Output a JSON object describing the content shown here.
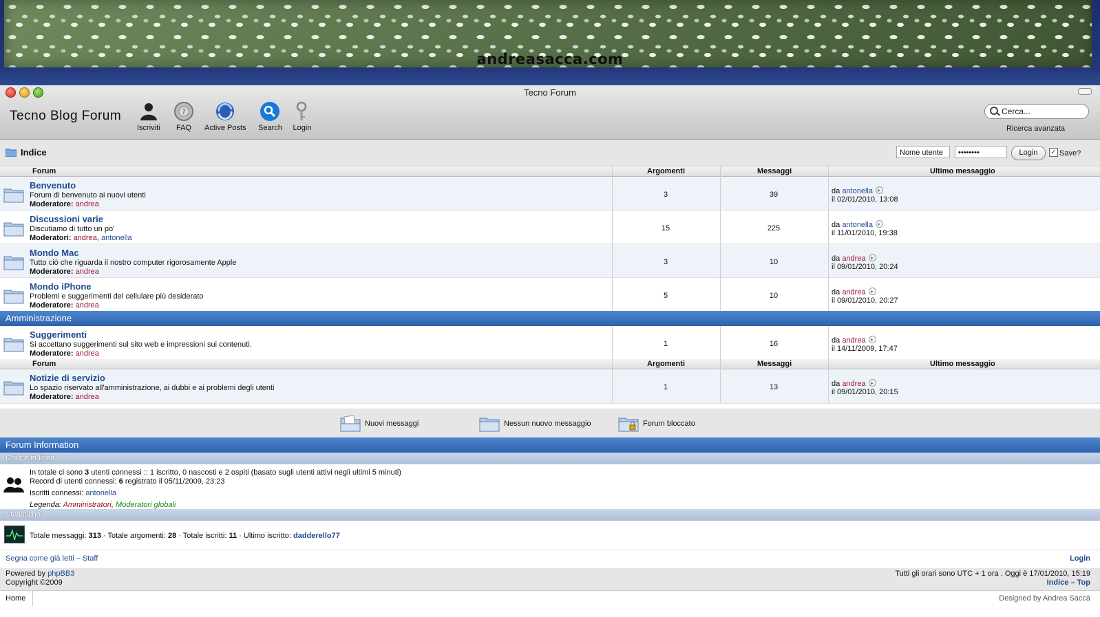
{
  "banner": {
    "site": "andreasacca.com"
  },
  "window": {
    "title": "Tecno Forum"
  },
  "header": {
    "brand": "Tecno Blog Forum",
    "toolbar": [
      {
        "label": "Iscriviti",
        "icon": "user-icon"
      },
      {
        "label": "FAQ",
        "icon": "faq-icon"
      },
      {
        "label": "Active Posts",
        "icon": "active-posts-icon"
      },
      {
        "label": "Search",
        "icon": "search-icon"
      },
      {
        "label": "Login",
        "icon": "key-icon"
      }
    ],
    "search_placeholder": "Cerca...",
    "advanced_search": "Ricerca avanzata"
  },
  "crumb": {
    "label": "Indice",
    "username_value": "Nome utente",
    "password_value": "••••••••",
    "login_button": "Login",
    "save_label": "Save?"
  },
  "table": {
    "headers": {
      "forum": "Forum",
      "topics": "Argomenti",
      "posts": "Messaggi",
      "last": "Ultimo messaggio"
    },
    "rows": [
      {
        "name": "Benvenuto",
        "desc": "Forum di benvenuto ai nuovi utenti",
        "mod_label": "Moderatore:",
        "mods": "andrea",
        "mods2": "",
        "topics": "3",
        "posts": "39",
        "last_by_prefix": "da",
        "last_by": "antonella",
        "last_date": "il 02/01/2010, 13:08"
      },
      {
        "name": "Discussioni varie",
        "desc": "Discutiamo di tutto un po'",
        "mod_label": "Moderatori:",
        "mods": "andrea",
        "mods2": "antonella",
        "topics": "15",
        "posts": "225",
        "last_by_prefix": "da",
        "last_by": "antonella",
        "last_date": "il 11/01/2010, 19:38"
      },
      {
        "name": "Mondo Mac",
        "desc": "Tutto ciò che riguarda il nostro computer rigorosamente Apple",
        "mod_label": "Moderatore:",
        "mods": "andrea",
        "mods2": "",
        "topics": "3",
        "posts": "10",
        "last_by_prefix": "da",
        "last_by": "andrea",
        "last_date": "il 09/01/2010, 20:24"
      },
      {
        "name": "Mondo iPhone",
        "desc": "Problemi e suggerimenti del cellulare più desiderato",
        "mod_label": "Moderatore:",
        "mods": "andrea",
        "mods2": "",
        "topics": "5",
        "posts": "10",
        "last_by_prefix": "da",
        "last_by": "andrea",
        "last_date": "il 09/01/2010, 20:27"
      }
    ],
    "category": "Amministrazione",
    "admin_rows": [
      {
        "name": "Suggerimenti",
        "desc": "Si accettano suggerimenti sul sito web e impressioni sui contenuti.",
        "mod_label": "Moderatore:",
        "mods": "andrea",
        "topics": "1",
        "posts": "16",
        "last_by_prefix": "da",
        "last_by": "andrea",
        "last_date": "il 14/11/2009, 17:47"
      },
      {
        "name": "Notizie di servizio",
        "desc": "Lo spazio riservato all'amministrazione, ai dubbi e ai problemi degli utenti",
        "mod_label": "Moderatore:",
        "mods": "andrea",
        "topics": "1",
        "posts": "13",
        "last_by_prefix": "da",
        "last_by": "andrea",
        "last_date": "il 09/01/2010, 20:15"
      }
    ]
  },
  "legend": {
    "new": "Nuovi messaggi",
    "none": "Nessun nuovo messaggio",
    "locked": "Forum bloccato"
  },
  "info": {
    "title": "Forum Information",
    "who_title": "Chi c'è in linea",
    "who_line1_a": "In totale ci sono ",
    "who_line1_n": "3",
    "who_line1_b": " utenti connessi :: 1 iscritto, 0 nascosti e 2 ospiti (basato sugli utenti attivi negli ultimi 5 minuti)",
    "record_a": "Record di utenti connessi: ",
    "record_n": "6",
    "record_b": " registrato il 05/11/2009, 23:23",
    "users_label": "Iscritti connessi: ",
    "users_value": "antonella",
    "legend_label": "Legenda: ",
    "legend_admin": "Amministratori",
    "legend_mod": "Moderatori globali",
    "stats_title": "Statistiche",
    "stat_msgs_label": "Totale messaggi: ",
    "stat_msgs": "313",
    "stat_topics_label": " · Totale argomenti: ",
    "stat_topics": "28",
    "stat_users_label": " · Totale iscritti: ",
    "stat_users": "11",
    "stat_last_label": " · Ultimo iscritto: ",
    "stat_last": "dadderello77"
  },
  "footer": {
    "mark_read": "Segna come già letti",
    "staff": "Staff",
    "login": "Login",
    "powered_by": "Powered by ",
    "phpbb": "phpBB3",
    "copyright": "Copyright ©2009",
    "times": "Tutti gli orari sono UTC + 1 ora . Oggi è 17/01/2010, 15:19",
    "index": "Indice",
    "top": "Top",
    "home": "Home",
    "designed": "Designed by Andrea Saccà"
  }
}
